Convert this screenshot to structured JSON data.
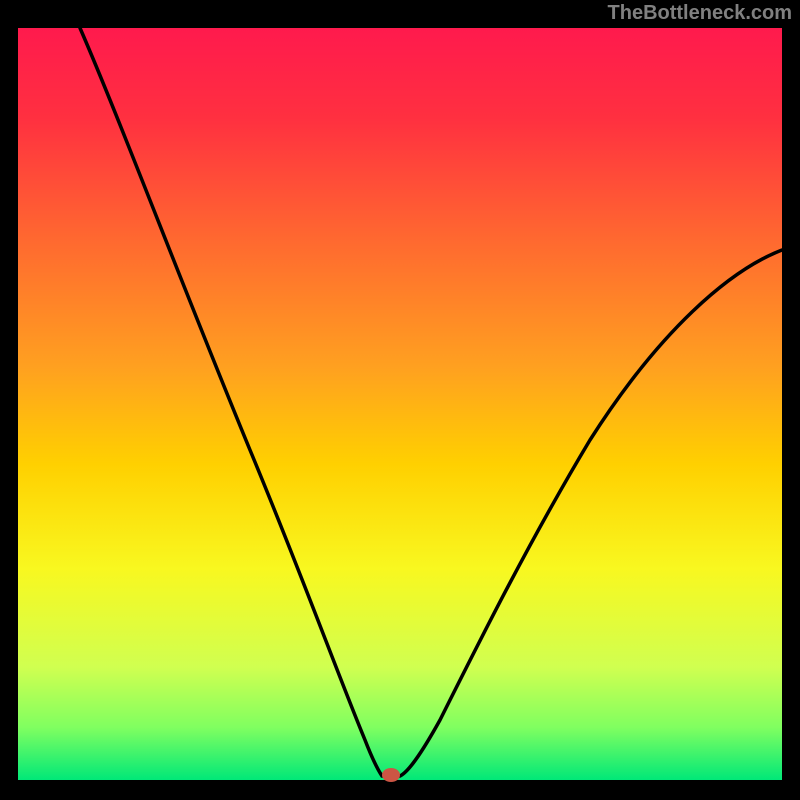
{
  "watermark": "TheBottleneck.com",
  "chart_data": {
    "type": "line",
    "title": "",
    "xlabel": "",
    "ylabel": "",
    "xlim": [
      0,
      100
    ],
    "ylim": [
      0,
      100
    ],
    "x": [
      0,
      5,
      10,
      15,
      20,
      25,
      30,
      35,
      40,
      42,
      44,
      46,
      48,
      50,
      55,
      60,
      65,
      70,
      75,
      80,
      85,
      90,
      95,
      100
    ],
    "values": [
      100,
      88,
      76,
      64,
      53,
      42,
      32,
      22,
      12,
      8,
      4,
      1,
      0,
      0.5,
      5,
      12,
      20,
      28,
      36,
      43,
      50,
      56,
      61,
      65
    ],
    "minimum_x": 47,
    "minimum_y": 0,
    "gradient_stops": [
      {
        "offset": 0.0,
        "color": "#ff1744"
      },
      {
        "offset": 0.35,
        "color": "#ff7730"
      },
      {
        "offset": 0.55,
        "color": "#ffdd00"
      },
      {
        "offset": 0.75,
        "color": "#eeff41"
      },
      {
        "offset": 0.9,
        "color": "#76ff03"
      },
      {
        "offset": 1.0,
        "color": "#00e676"
      }
    ]
  }
}
